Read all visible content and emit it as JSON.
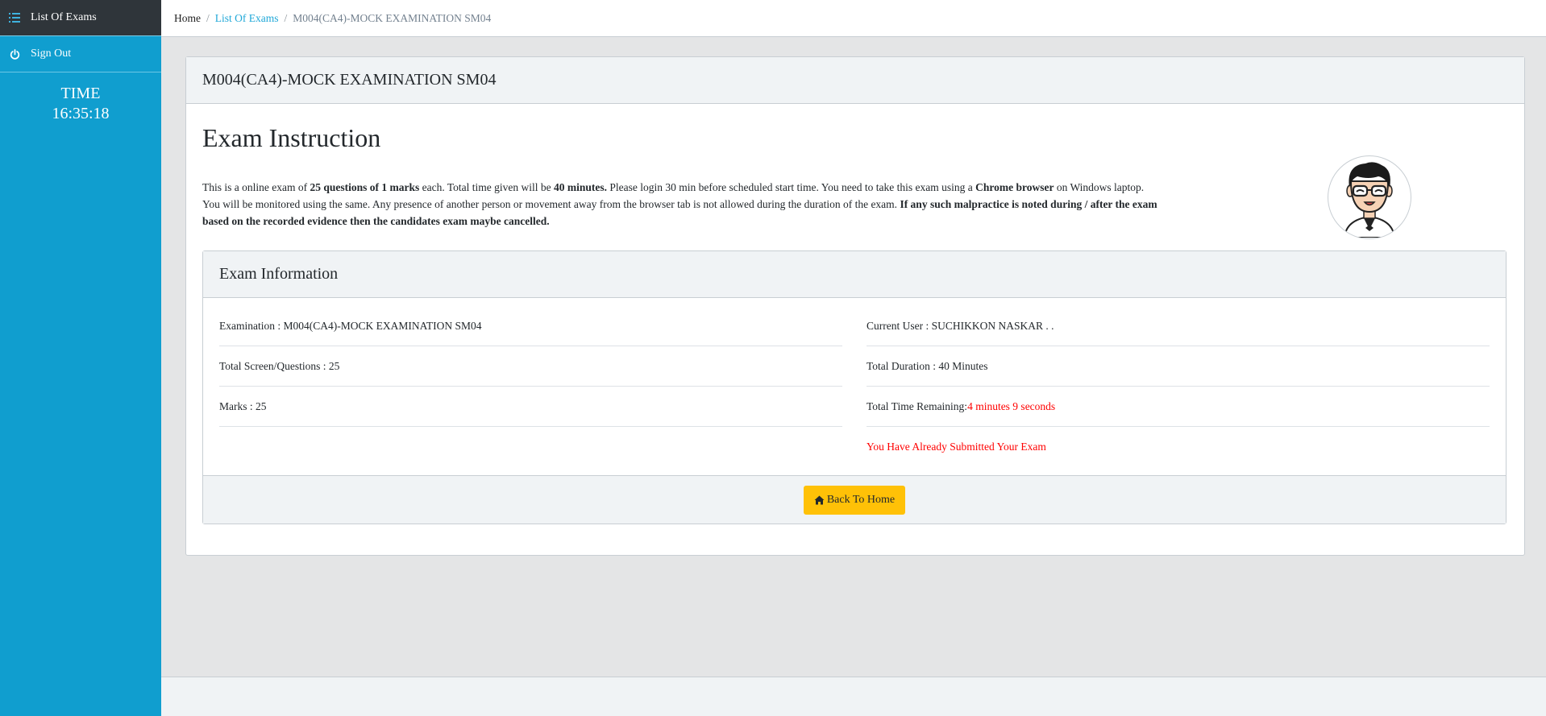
{
  "sidebar": {
    "items": [
      {
        "label": "List Of Exams",
        "icon": "list-icon"
      },
      {
        "label": "Sign Out",
        "icon": "power-icon"
      }
    ],
    "time_label": "TIME",
    "time_value": "16:35:18"
  },
  "breadcrumb": {
    "home": "Home",
    "list": "List Of Exams",
    "current": "M004(CA4)-MOCK EXAMINATION SM04"
  },
  "card": {
    "title": "M004(CA4)-MOCK EXAMINATION SM04"
  },
  "instruction": {
    "heading": "Exam Instruction",
    "p1": "This is a online exam of ",
    "b1": "25 questions of 1 marks",
    "p2": " each. Total time given will be ",
    "b2": "40 minutes.",
    "p3": " Please login 30 min before scheduled start time. You need to take this exam using a ",
    "b3": "Chrome browser",
    "p4": " on Windows laptop. You will be monitored using the same. Any presence of another person or movement away from the browser tab is not allowed during the duration of the exam. ",
    "b4": "If any such malpractice is noted during / after the exam based on the recorded evidence then the candidates exam maybe cancelled."
  },
  "info": {
    "heading": "Exam Information",
    "left": [
      "Examination : M004(CA4)-MOCK EXAMINATION SM04",
      "Total Screen/Questions : 25",
      "Marks : 25"
    ],
    "current_user": "Current User : SUCHIKKON NASKAR . .",
    "duration": "Total Duration : 40 Minutes",
    "remaining_label": "Total Time Remaining: ",
    "remaining_value": "4 minutes 9 seconds",
    "submitted": "You Have Already Submitted Your Exam",
    "button_label": "Back To Home"
  },
  "colors": {
    "sidebar": "#109ecf",
    "accent_link": "#20a8d8",
    "button": "#ffc107",
    "alert": "#ff0000"
  }
}
